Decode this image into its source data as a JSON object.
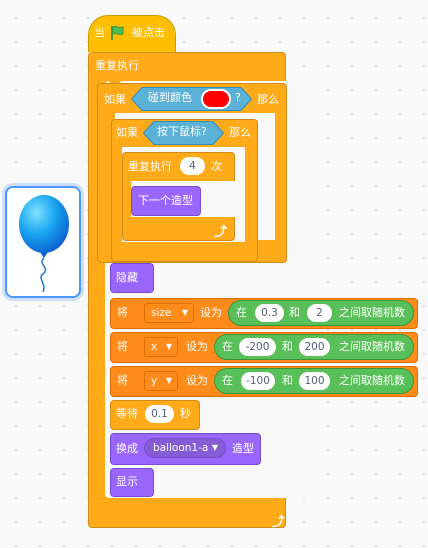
{
  "colors": {
    "control": "#ffab19",
    "event": "#ffbf00",
    "looks": "#9966ff",
    "operator": "#59c059",
    "sensing": "#5cb1d6",
    "variable": "#ff8c1a",
    "touch_color": "#ff0000"
  },
  "hat": {
    "when": "当",
    "flag_icon": "green-flag",
    "clicked": "被点击"
  },
  "forever": {
    "label": "重复执行"
  },
  "if1": {
    "if": "如果",
    "touching_color": "碰到颜色",
    "q": "?",
    "then": "那么"
  },
  "if2": {
    "if": "如果",
    "mouse_down": "按下鼠标?",
    "then": "那么"
  },
  "repeat": {
    "label": "重复执行",
    "count": "4",
    "times": "次"
  },
  "next_costume": {
    "label": "下一个造型"
  },
  "hide": {
    "label": "隐藏"
  },
  "set_size": {
    "set": "将",
    "var": "size",
    "to": "设为",
    "in": "在",
    "from": "0.3",
    "and": "和",
    "to_val": "2",
    "random": "之间取随机数"
  },
  "set_x": {
    "set": "将",
    "var": "x",
    "to": "设为",
    "in": "在",
    "from": "-200",
    "and": "和",
    "to_val": "200",
    "random": "之间取随机数"
  },
  "set_y": {
    "set": "将",
    "var": "y",
    "to": "设为",
    "in": "在",
    "from": "-100",
    "and": "和",
    "to_val": "100",
    "random": "之间取随机数"
  },
  "wait": {
    "label": "等待",
    "secs": "0.1",
    "unit": "秒"
  },
  "switch_costume": {
    "label": "换成",
    "costume": "balloon1-a",
    "suffix": "造型"
  },
  "show": {
    "label": "显示"
  }
}
